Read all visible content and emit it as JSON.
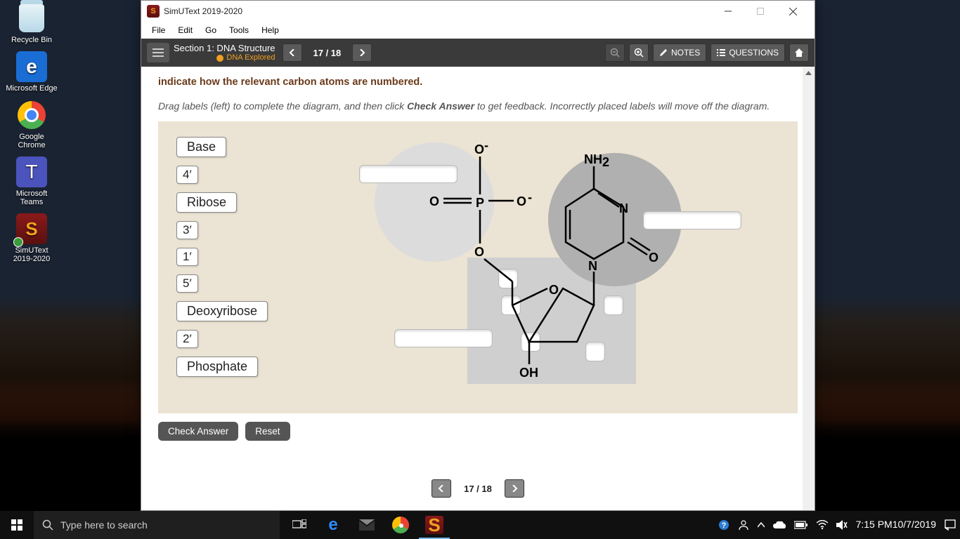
{
  "desktop": {
    "icons": [
      {
        "label": "Recycle Bin"
      },
      {
        "label": "Microsoft Edge"
      },
      {
        "label": "Google Chrome"
      },
      {
        "label": "Microsoft Teams"
      },
      {
        "label": "SimUText 2019-2020"
      }
    ]
  },
  "window": {
    "title": "SimUText 2019-2020",
    "menu": [
      "File",
      "Edit",
      "Go",
      "Tools",
      "Help"
    ],
    "section_title": "Section 1: DNA Structure",
    "section_sub": "DNA Explored",
    "page_indicator": "17 / 18",
    "notes_label": "NOTES",
    "questions_label": "QUESTIONS"
  },
  "content": {
    "heading": "indicate how the relevant carbon atoms are numbered.",
    "instruction_pre": "Drag labels (left) to complete the diagram, and then click ",
    "instruction_bold": "Check Answer",
    "instruction_post": " to get feedback. Incorrectly placed labels will move off the diagram.",
    "labels": [
      "Base",
      "4′",
      "Ribose",
      "3′",
      "1′",
      "5′",
      "Deoxyribose",
      "2′",
      "Phosphate"
    ],
    "chem": {
      "o_minus_top": "O",
      "minus": "-",
      "p": "P",
      "o_dbl": "O",
      "o_right": "O",
      "nh2": "NH",
      "nh2_sub": "2",
      "n1": "N",
      "n2": "N",
      "o_carbonyl": "O",
      "o_ring": "O",
      "oh": "OH"
    },
    "check_answer": "Check Answer",
    "reset": "Reset",
    "footer_page": "17 / 18"
  },
  "taskbar": {
    "search_placeholder": "Type here to search",
    "time": "7:15 PM",
    "date": "10/7/2019"
  }
}
